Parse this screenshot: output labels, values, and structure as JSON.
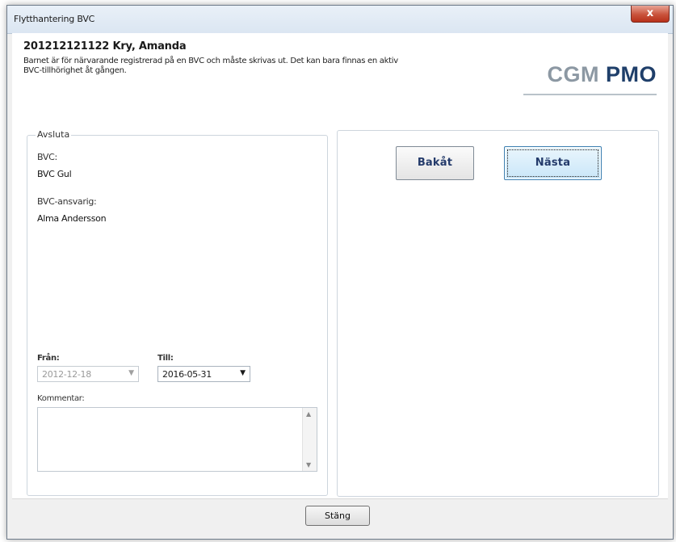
{
  "window": {
    "title": "Flytthantering BVC",
    "close_glyph": "x"
  },
  "header": {
    "patient": "201212121122 Kry, Amanda",
    "info_line1": "Barnet är  för närvarande registrerad på en BVC och måste skrivas ut. Det kan bara finnas en aktiv",
    "info_line2": "BVC-tillhörighet åt gången.",
    "logo_cgm": "CGM",
    "logo_pmo": "PMO"
  },
  "avsluta": {
    "legend": "Avsluta",
    "bvc_label": "BVC:",
    "bvc_value": "BVC Gul",
    "responsible_label": "BVC-ansvarig:",
    "responsible_value": "Alma Andersson",
    "from_label": "Från:",
    "from_value": "2012-12-18",
    "to_label": "Till:",
    "to_value": "2016-05-31",
    "comment_label": "Kommentar:",
    "comment_value": ""
  },
  "nav": {
    "back_label": "Bakåt",
    "next_label": "Nästa"
  },
  "footer": {
    "close_label": "Stäng"
  },
  "icons": {
    "dropdown": "chevron-down-icon",
    "scroll_up": "scroll-up-icon",
    "scroll_down": "scroll-down-icon",
    "close": "close-icon"
  },
  "colors": {
    "logo_gray": "#8c98a3",
    "logo_blue": "#1f3f6a",
    "close_red": "#c9533c",
    "focus_blue": "#3c7fb1"
  }
}
